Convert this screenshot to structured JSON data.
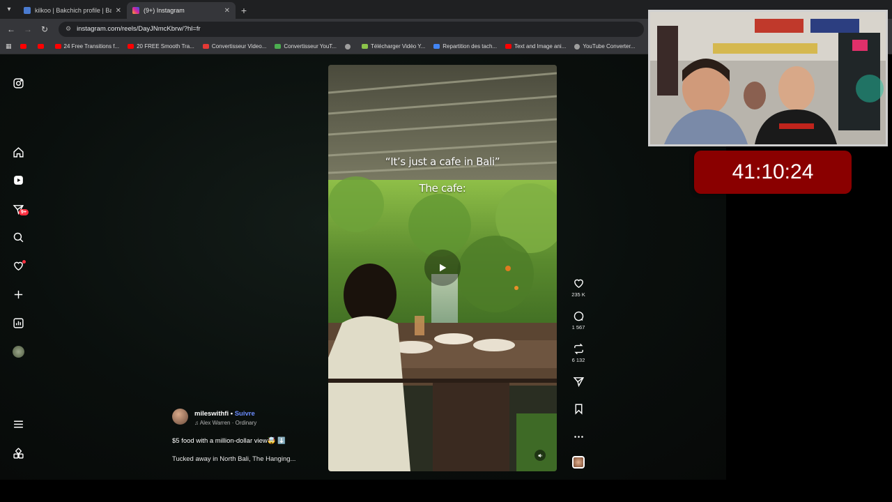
{
  "browser": {
    "tabs": [
      {
        "title": "kilkoo | Bakchich profile | Bakch",
        "active": false,
        "favicon_color": "#4a7bd0"
      },
      {
        "title": "(9+) Instagram",
        "active": true,
        "favicon_color": "#d6249f"
      }
    ],
    "url": "instagram.com/reels/DayJNmcKbrw/?hl=fr",
    "bookmarks": [
      {
        "label": "",
        "color": "#ff0000"
      },
      {
        "label": "",
        "color": "#ff0000"
      },
      {
        "label": "24 Free Transitions f...",
        "color": "#ff0000"
      },
      {
        "label": "20 FREE Smooth Tra...",
        "color": "#ff0000"
      },
      {
        "label": "Convertisseur Video...",
        "color": "#e53935"
      },
      {
        "label": "Convertisseur YouT...",
        "color": "#4caf50"
      },
      {
        "label": "",
        "color": "#9e9e9e"
      },
      {
        "label": "Télécharger Vidéo Y...",
        "color": "#8bc34a"
      },
      {
        "label": "Repartition des tach...",
        "color": "#4285f4"
      },
      {
        "label": "Text and Image ani...",
        "color": "#ff0000"
      },
      {
        "label": "YouTube Converter...",
        "color": "#9e9e9e"
      }
    ]
  },
  "sidebar": {
    "notification_badge": "9+"
  },
  "reel": {
    "overlay_line1": "“It’s just a cafe in Bali”",
    "overlay_line2": "The cafe:"
  },
  "actions": {
    "likes": "235 K",
    "comments": "1 567",
    "reposts": "6 132"
  },
  "post": {
    "username": "mileswithfi",
    "follow_label": "Suivre",
    "separator": "•",
    "audio": "Alex Warren · Ordinary",
    "caption_line1": "$5 food with a million-dollar view🤯 ⬇️",
    "caption_line2": "Tucked away in North Bali, The Hanging..."
  },
  "stream": {
    "timer": "41:10:24"
  }
}
